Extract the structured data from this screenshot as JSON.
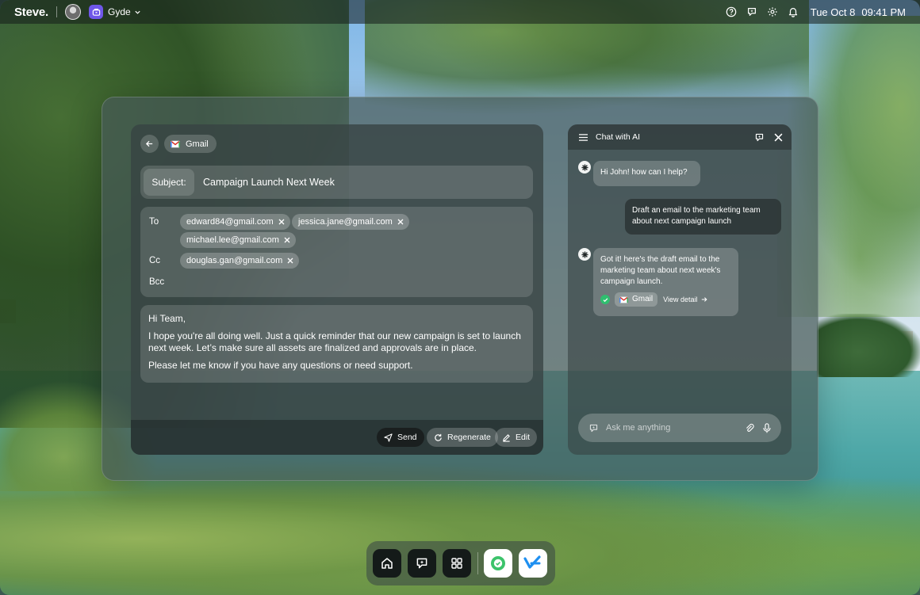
{
  "topbar": {
    "logo": "Steve.",
    "workspace_name": "Gyde",
    "date": "Tue Oct 8",
    "time": "09:41 PM"
  },
  "email": {
    "app_name": "Gmail",
    "subject_label": "Subject:",
    "subject_value": "Campaign Launch Next Week",
    "to_label": "To",
    "cc_label": "Cc",
    "bcc_label": "Bcc",
    "to": [
      "edward84@gmail.com",
      "jessica.jane@gmail.com",
      "michael.lee@gmail.com"
    ],
    "cc": [
      "douglas.gan@gmail.com"
    ],
    "body": {
      "greeting": "Hi Team,",
      "paragraph1": "I hope you're all doing well. Just a quick reminder that our new campaign is set to launch next week. Let’s make sure all assets are finalized and approvals are in place.",
      "paragraph2": "Please let me know if you have any questions or need support."
    },
    "actions": {
      "send": "Send",
      "regenerate": "Regenerate",
      "edit": "Edit"
    }
  },
  "chat": {
    "title": "Chat with AI",
    "messages": [
      {
        "from": "ai",
        "text": "Hi John! how can I help?"
      },
      {
        "from": "user",
        "text": "Draft an email to the marketing team about next campaign launch"
      },
      {
        "from": "ai",
        "text": "Got it! here's the draft email to the marketing team about next week's campaign launch."
      }
    ],
    "attachment_app": "Gmail",
    "view_detail": "View detail",
    "input_placeholder": "Ask me anything"
  },
  "colors": {
    "workspace_accent": "#6f57e8",
    "success": "#2fbf6f"
  },
  "dock": {
    "items": [
      "home-icon",
      "chat-ai-icon",
      "apps-grid-icon",
      "green-shield-app-icon",
      "blue-check-app-icon"
    ]
  }
}
